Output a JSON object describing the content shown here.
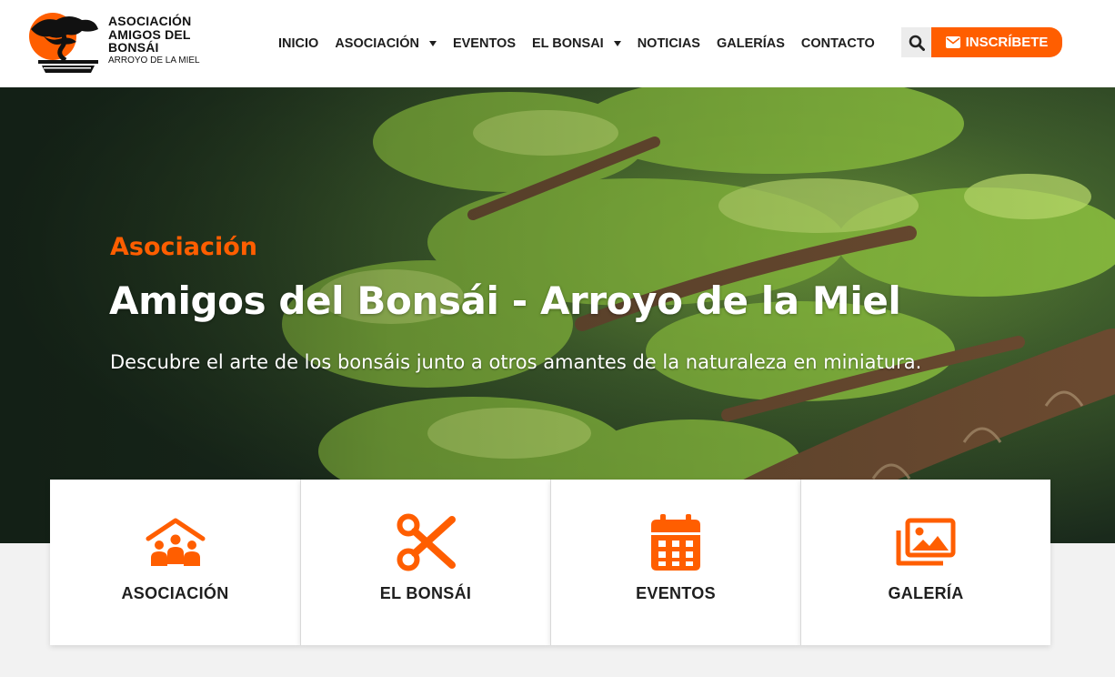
{
  "brand": {
    "logo_lines": [
      "ASOCIACIÓN",
      "AMIGOS DEL",
      "BONSÁI"
    ],
    "logo_subline": "ARROYO DE LA MIEL",
    "accent_color": "#ff5e00"
  },
  "nav": {
    "items": [
      {
        "label": "INICIO",
        "has_dropdown": false
      },
      {
        "label": "ASOCIACIÓN",
        "has_dropdown": true
      },
      {
        "label": "EVENTOS",
        "has_dropdown": false
      },
      {
        "label": "EL BONSAI",
        "has_dropdown": true
      },
      {
        "label": "NOTICIAS",
        "has_dropdown": false
      },
      {
        "label": "GALERÍAS",
        "has_dropdown": false
      },
      {
        "label": "CONTACTO",
        "has_dropdown": false
      }
    ],
    "search_icon": "search-icon",
    "cta_label": "INSCRÍBETE",
    "cta_icon": "envelope-icon"
  },
  "hero": {
    "kicker": "Asociación",
    "title": "Amigos del Bonsái - Arroyo de la Miel",
    "subtitle": "Descubre el arte de los bonsáis junto a otros amantes de la naturaleza en miniatura."
  },
  "cards": [
    {
      "label": "ASOCIACIÓN",
      "icon": "people-house-icon"
    },
    {
      "label": "EL BONSÁI",
      "icon": "scissors-icon"
    },
    {
      "label": "EVENTOS",
      "icon": "calendar-icon"
    },
    {
      "label": "GALERÍA",
      "icon": "images-icon"
    }
  ]
}
